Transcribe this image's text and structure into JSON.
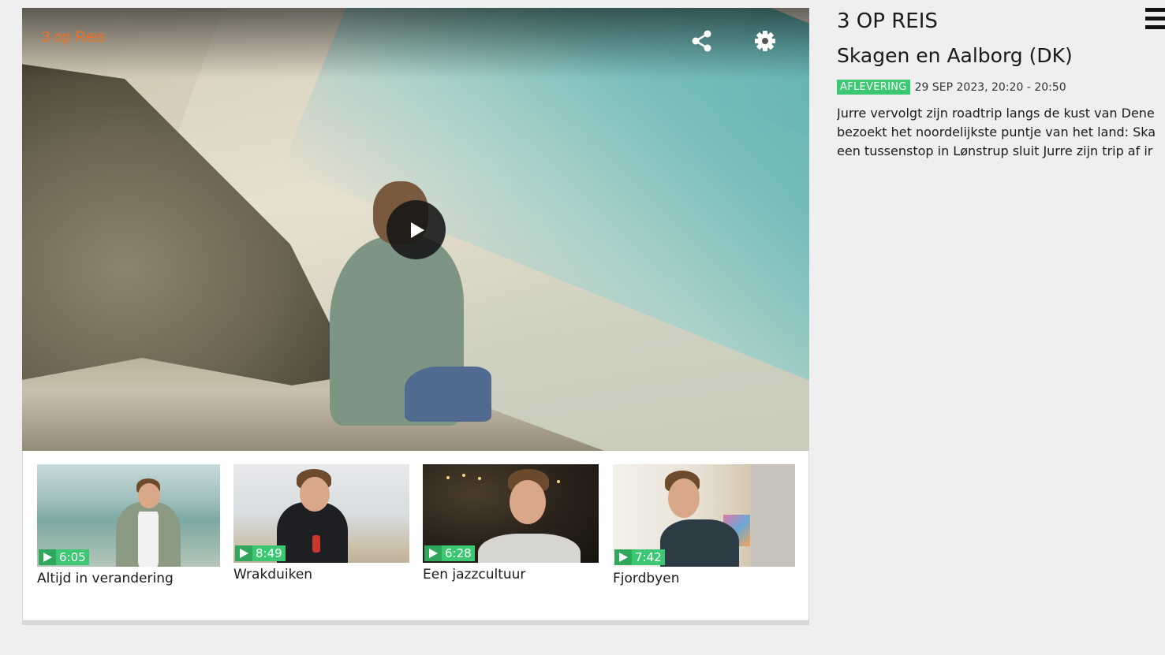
{
  "player": {
    "brand": "3 op Reis",
    "share_icon": "share-icon",
    "settings_icon": "gear-icon",
    "play_icon": "play-icon"
  },
  "clips": [
    {
      "title": "Altijd in verandering",
      "duration": "6:05"
    },
    {
      "title": "Wrakduiken",
      "duration": "8:49"
    },
    {
      "title": "Een jazzcultuur",
      "duration": "6:28"
    },
    {
      "title": "Fjordbyen",
      "duration": "7:42"
    }
  ],
  "sidebar": {
    "series_title": "3 OP REIS",
    "episode_title": "Skagen en Aalborg (DK)",
    "badge": "AFLEVERING",
    "broadcast": "29 SEP 2023, 20:20 - 20:50",
    "description_lines": [
      "Jurre vervolgt zijn roadtrip langs de kust van Dene",
      "bezoekt het noordelijkste puntje van het land: Ska",
      "een tussenstop in Lønstrup sluit Jurre zijn trip af ir"
    ]
  },
  "menu_icon": "hamburger-menu-icon",
  "colors": {
    "brand_orange": "#f26f20",
    "badge_green": "#3cc873",
    "background": "#efefef"
  }
}
